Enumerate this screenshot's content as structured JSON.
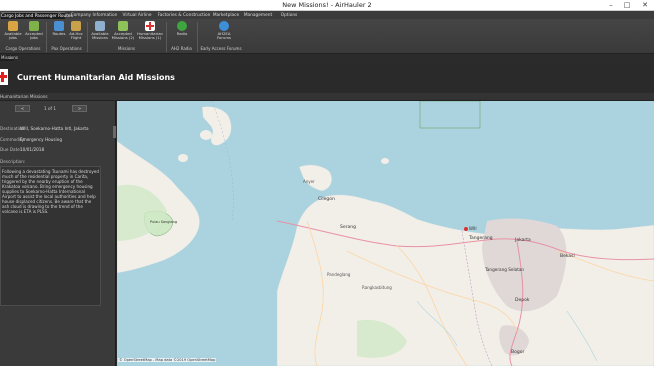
{
  "window": {
    "title": "New Missions! - AirHauler 2",
    "minimize": "–",
    "maximize": "□",
    "close": "✕"
  },
  "tabs": [
    {
      "label": "Cargo Jobs and Passenger Routes",
      "active": true
    },
    {
      "label": "Company Information",
      "active": false
    },
    {
      "label": "Virtual Airline",
      "active": false
    },
    {
      "label": "Factories & Construction",
      "active": false
    },
    {
      "label": "Marketplace",
      "active": false
    },
    {
      "label": "Management",
      "active": false
    },
    {
      "label": "Options",
      "active": false
    }
  ],
  "ribbon": {
    "buttons": [
      {
        "label": "Available Jobs",
        "icon": "available-jobs-icon",
        "color": "#d9a441"
      },
      {
        "label": "Accepted Jobs",
        "icon": "accepted-jobs-icon",
        "color": "#7fb24a"
      },
      {
        "label": "Routes",
        "icon": "routes-icon",
        "color": "#4a8fd0"
      },
      {
        "label": "Ad-Hoc Flight",
        "icon": "adhoc-flight-icon",
        "color": "#c7a24a"
      },
      {
        "label": "Available Missions",
        "icon": "available-missions-icon",
        "color": "#8fb0cf"
      },
      {
        "label": "Accepted Missions (2)",
        "icon": "accepted-missions-icon",
        "color": "#8fc15a"
      },
      {
        "label": "Humanitarian Missions (1)",
        "icon": "humanitarian-missions-icon",
        "color": "#e03030"
      },
      {
        "label": "Radio",
        "icon": "radio-icon",
        "color": "#3ea63e"
      },
      {
        "label": "AH2EA Forums",
        "icon": "forums-icon",
        "color": "#3d8fd8"
      }
    ],
    "groups": [
      "Cargo Operations",
      "Pax Operations",
      "Missions",
      "AH2 Radio",
      "Early Access Forums"
    ]
  },
  "doc_tab": {
    "label": "Missions",
    "close": "x"
  },
  "header": {
    "title": "Current Humanitarian Aid Missions"
  },
  "subtab": {
    "label": "Humanitarian Missions"
  },
  "mission": {
    "prev": "<",
    "next": ">",
    "counter": "1 of 1",
    "fields": [
      {
        "label": "Destination:",
        "value": "WIII, Soekarno-Hatta Intl, Jakarta"
      },
      {
        "label": "Commodity:",
        "value": "Emergency Housing"
      },
      {
        "label": "Due Date:",
        "value": "10/01/2018"
      }
    ],
    "description_label": "Description:",
    "description": "Following a devastating Tsunami has destroyed much of the residential property in Carita, triggered by the nearby eruption of the Krakatoa volcano. Bring emergency housing supplies to Soekarno-Hatta International Airport to assist the local authorities and help house displaced citizens. Be aware that the ash cloud is drawing to the trend of the volcano is ETA is PLSS."
  },
  "map": {
    "attribution": "© OpenStreetMap - Map data ©2019 OpenStreetMap",
    "sea_color": "#aad3df",
    "land_color": "#f2efe9",
    "places": [
      "Cilegon",
      "Serang",
      "Tangerang",
      "Jakarta",
      "Bekasi",
      "Tangerang Selatan",
      "Depok",
      "Bogor",
      "Pandeglang",
      "Rangkasbitung",
      "Pulau Sangiang",
      "Anyer",
      "WIII"
    ]
  }
}
